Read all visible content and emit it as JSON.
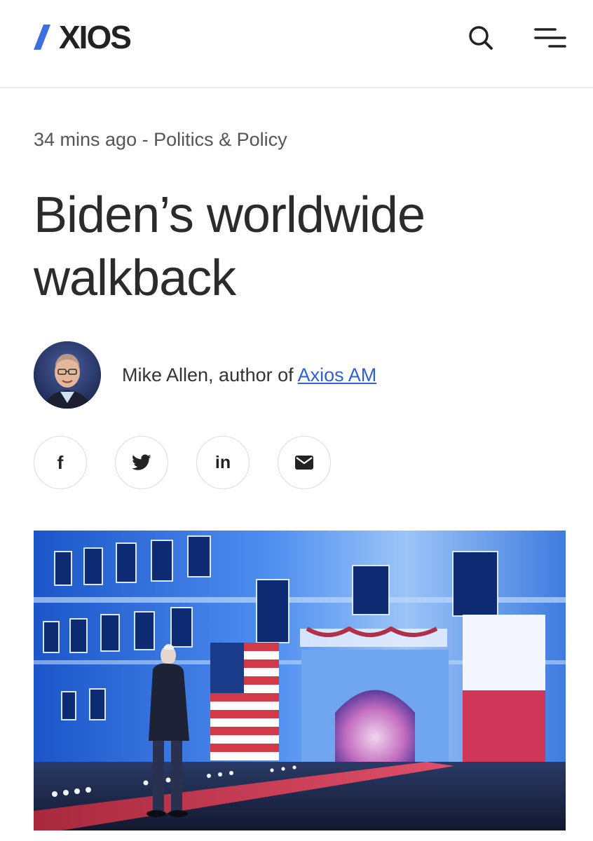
{
  "header": {
    "logo_text": "XIOS",
    "logo_name": "AXIOS",
    "search_icon": "search-icon",
    "menu_icon": "menu-icon"
  },
  "article": {
    "time_ago": "34 mins ago",
    "separator": " - ",
    "category": "Politics & Policy",
    "headline": "Biden’s worldwide walkback",
    "byline_prefix": "Mike Allen, author of ",
    "byline_link": "Axios AM"
  },
  "share": [
    {
      "icon": "facebook-icon",
      "glyph": "f"
    },
    {
      "icon": "twitter-icon",
      "glyph": ""
    },
    {
      "icon": "linkedin-icon",
      "glyph": "in"
    },
    {
      "icon": "email-icon",
      "glyph": ""
    }
  ],
  "colors": {
    "accent": "#2f5fd6",
    "logo_blue": "#3c6fe0",
    "text": "#333333",
    "divider": "#e9e9ee"
  }
}
